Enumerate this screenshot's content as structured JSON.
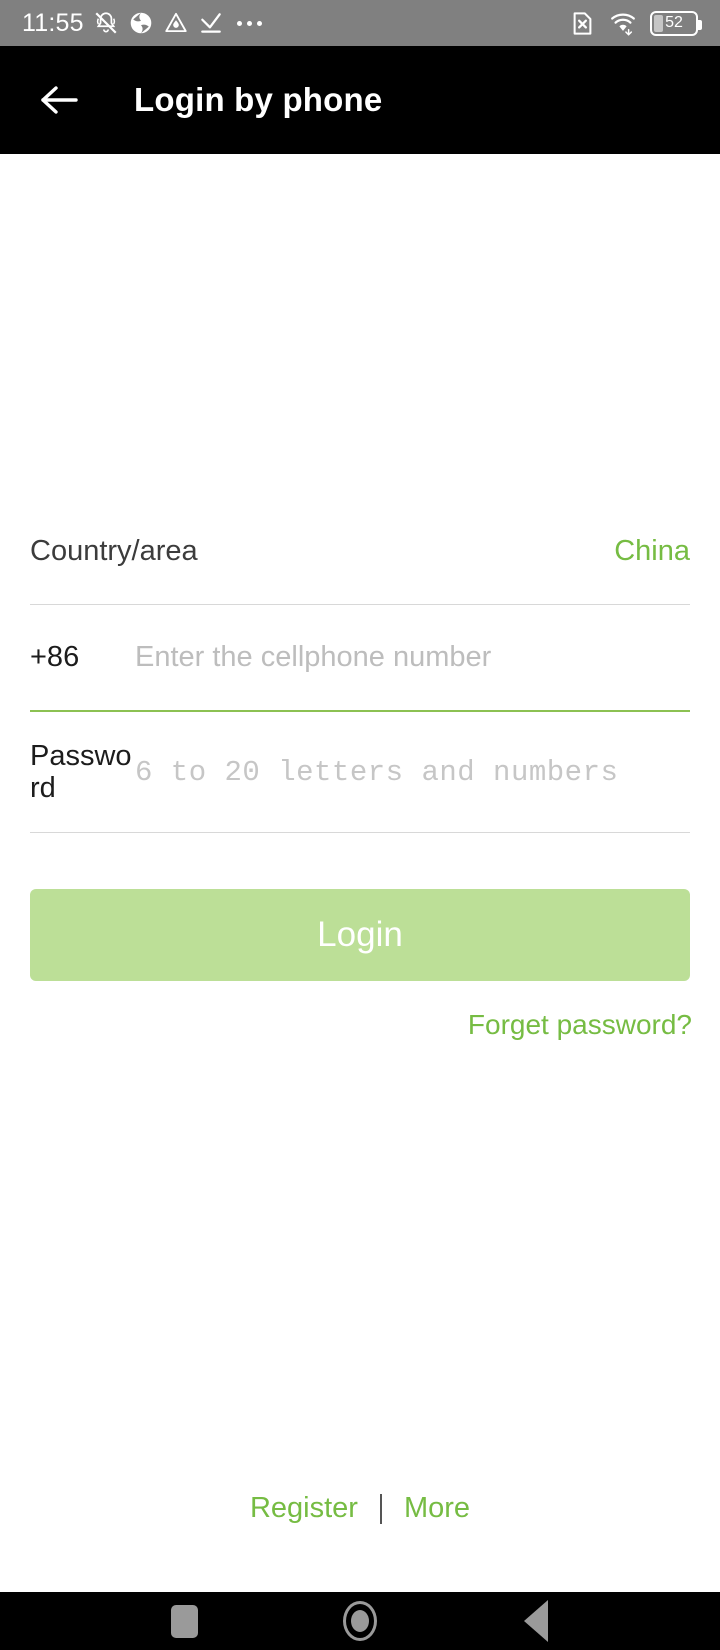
{
  "status_bar": {
    "time": "11:55",
    "battery_percent": "52",
    "icons": [
      "bell-muted-icon",
      "app-circle-icon",
      "triangle-drop-icon",
      "check-down-icon",
      "overflow-dots-icon",
      "sim-missing-icon",
      "wifi-icon",
      "battery-icon"
    ]
  },
  "app_bar": {
    "back_icon": "back-arrow-icon",
    "title": "Login by phone"
  },
  "form": {
    "country": {
      "label": "Country/area",
      "value": "China"
    },
    "phone": {
      "prefix": "+86",
      "placeholder": "Enter the cellphone number",
      "value": ""
    },
    "password": {
      "label": "Password",
      "placeholder": "6 to 20 letters and numbers",
      "value": ""
    },
    "login_button": "Login",
    "forget_password": "Forget password?"
  },
  "footer": {
    "register": "Register",
    "separator": "|",
    "more": "More"
  },
  "nav_bar": {
    "recents": "recents-square-icon",
    "home": "home-circle-icon",
    "back": "back-triangle-icon"
  },
  "colors": {
    "accent_green": "#76bc43",
    "button_green": "#bcdf97",
    "status_bar_gray": "#808080",
    "app_bar_black": "#000000"
  }
}
